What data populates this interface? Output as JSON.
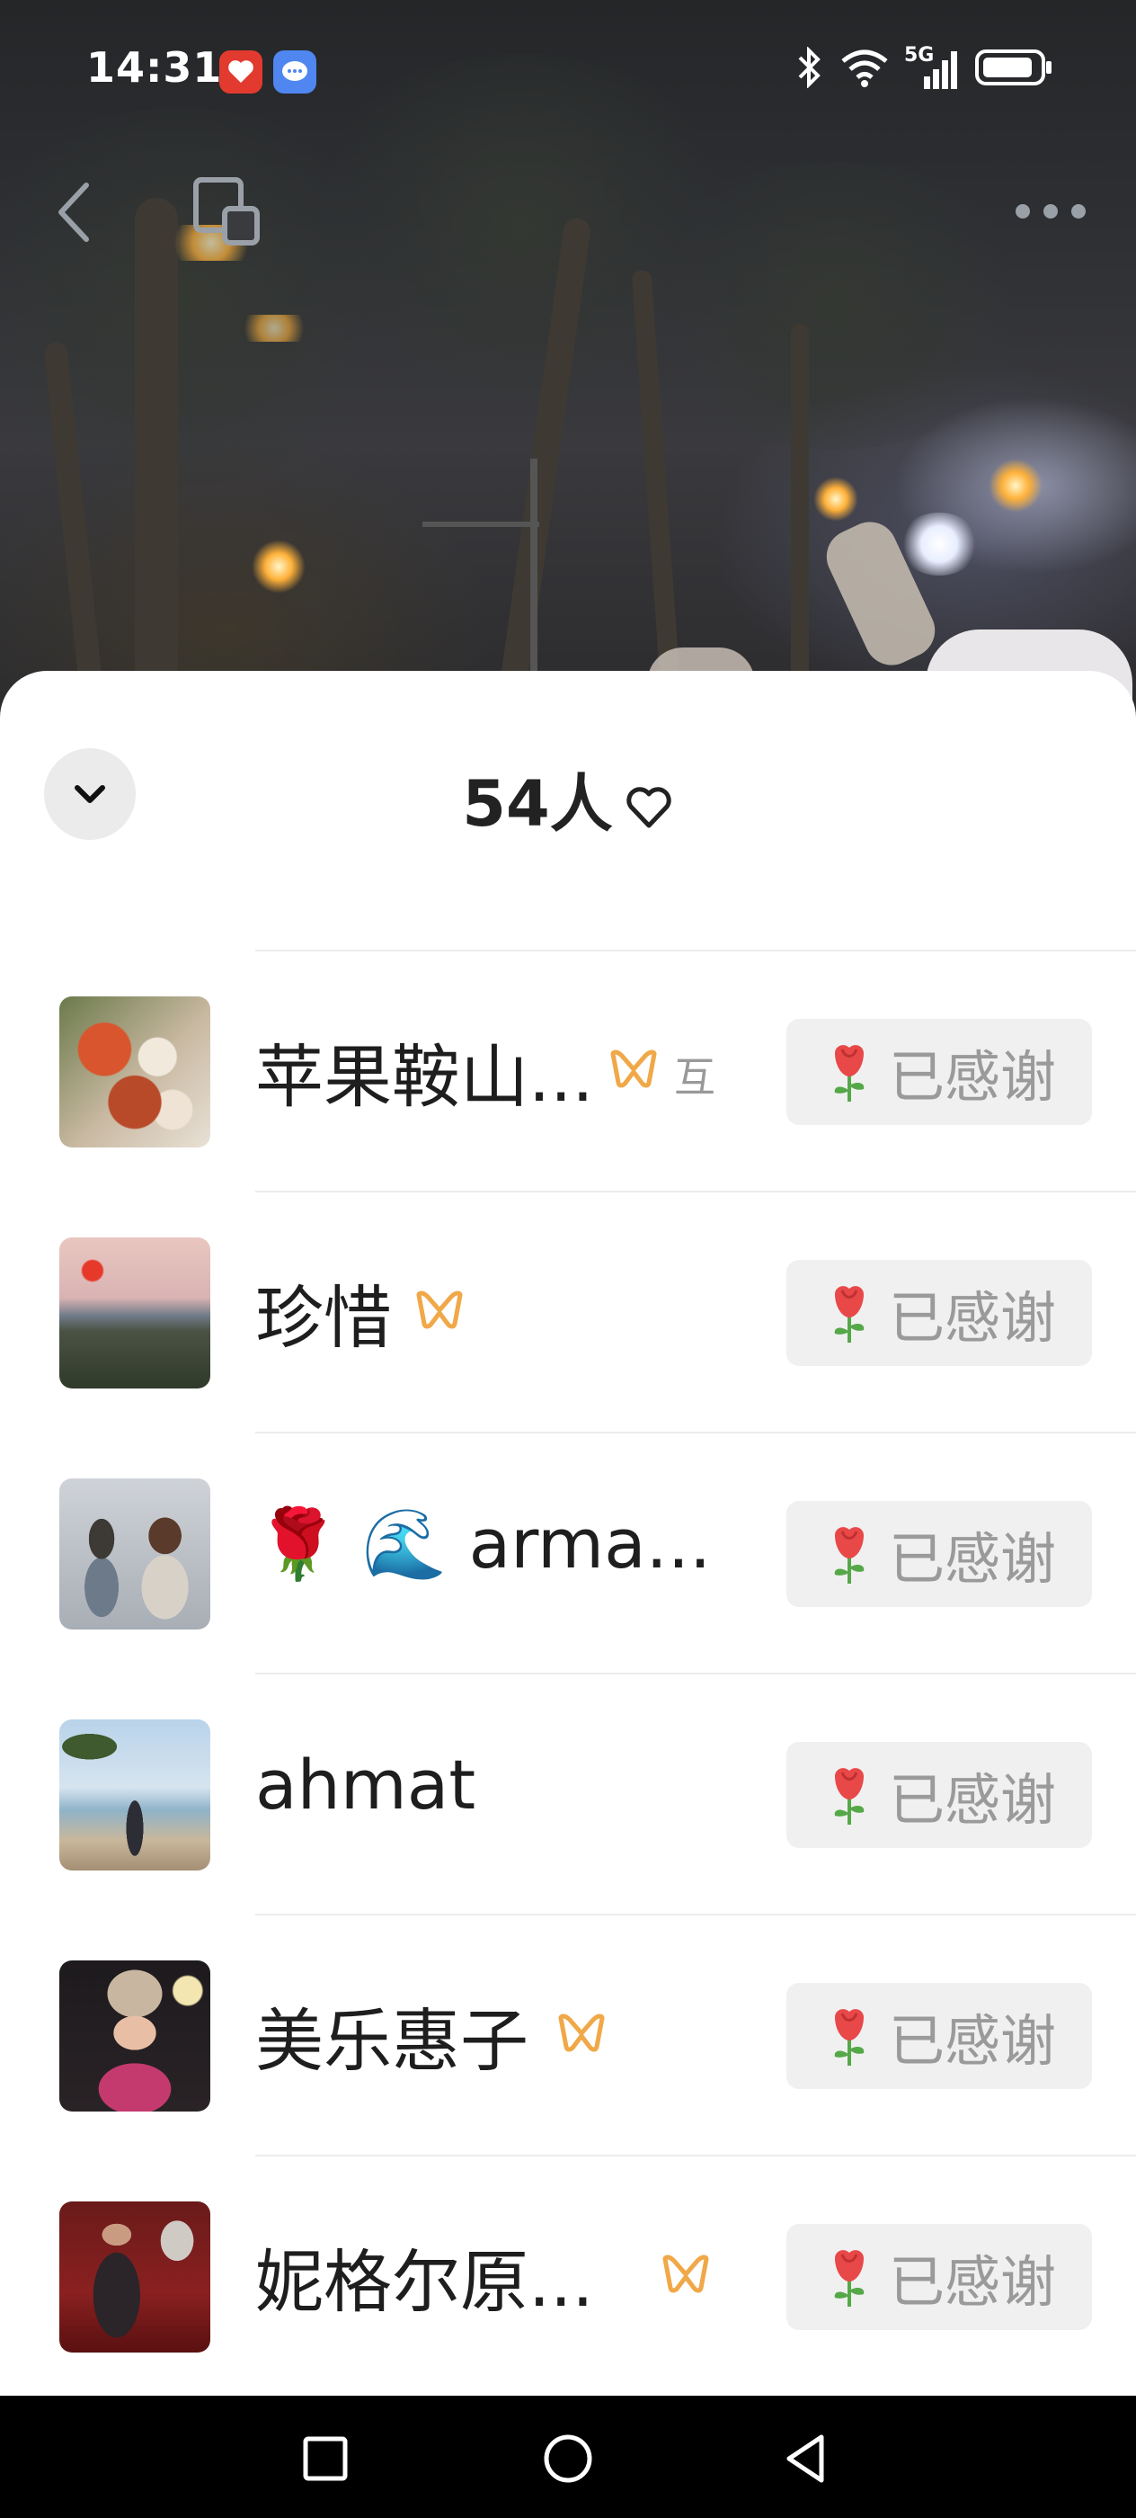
{
  "status_bar": {
    "time": "14:31",
    "network": "5G",
    "icons": [
      "bluetooth-icon",
      "wifi-icon",
      "signal-icon",
      "battery-icon"
    ],
    "notification_apps": [
      "red-app-icon",
      "blue-message-icon"
    ]
  },
  "top_nav": {
    "icons": [
      "back-icon",
      "cast-icon",
      "more-icon"
    ]
  },
  "sheet": {
    "count": "54人",
    "heart_icon": "heart-outline-icon",
    "collapse_icon": "chevron-down-icon"
  },
  "supporters": [
    {
      "name": "苹果鞍山...",
      "badge": true,
      "mutual": "互",
      "action": "已感谢",
      "avatar": "flowers"
    },
    {
      "name": "珍惜",
      "badge": true,
      "mutual": "",
      "action": "已感谢",
      "avatar": "pagoda-sunset"
    },
    {
      "name": "🌹 🌊 arma...",
      "badge": false,
      "mutual": "",
      "action": "已感谢",
      "avatar": "couple"
    },
    {
      "name": "ahmat",
      "badge": false,
      "mutual": "",
      "action": "已感谢",
      "avatar": "beach"
    },
    {
      "name": "美乐惠子",
      "badge": true,
      "mutual": "",
      "action": "已感谢",
      "avatar": "costume"
    },
    {
      "name": "妮格尔原...",
      "badge": true,
      "mutual": "",
      "action": "已感谢",
      "avatar": "horse-rider"
    }
  ],
  "colors": {
    "badge": "#F0A848",
    "thanks_bg": "#F0F0F0",
    "thanks_text": "#9A9A9A",
    "rose": "#E84848"
  }
}
